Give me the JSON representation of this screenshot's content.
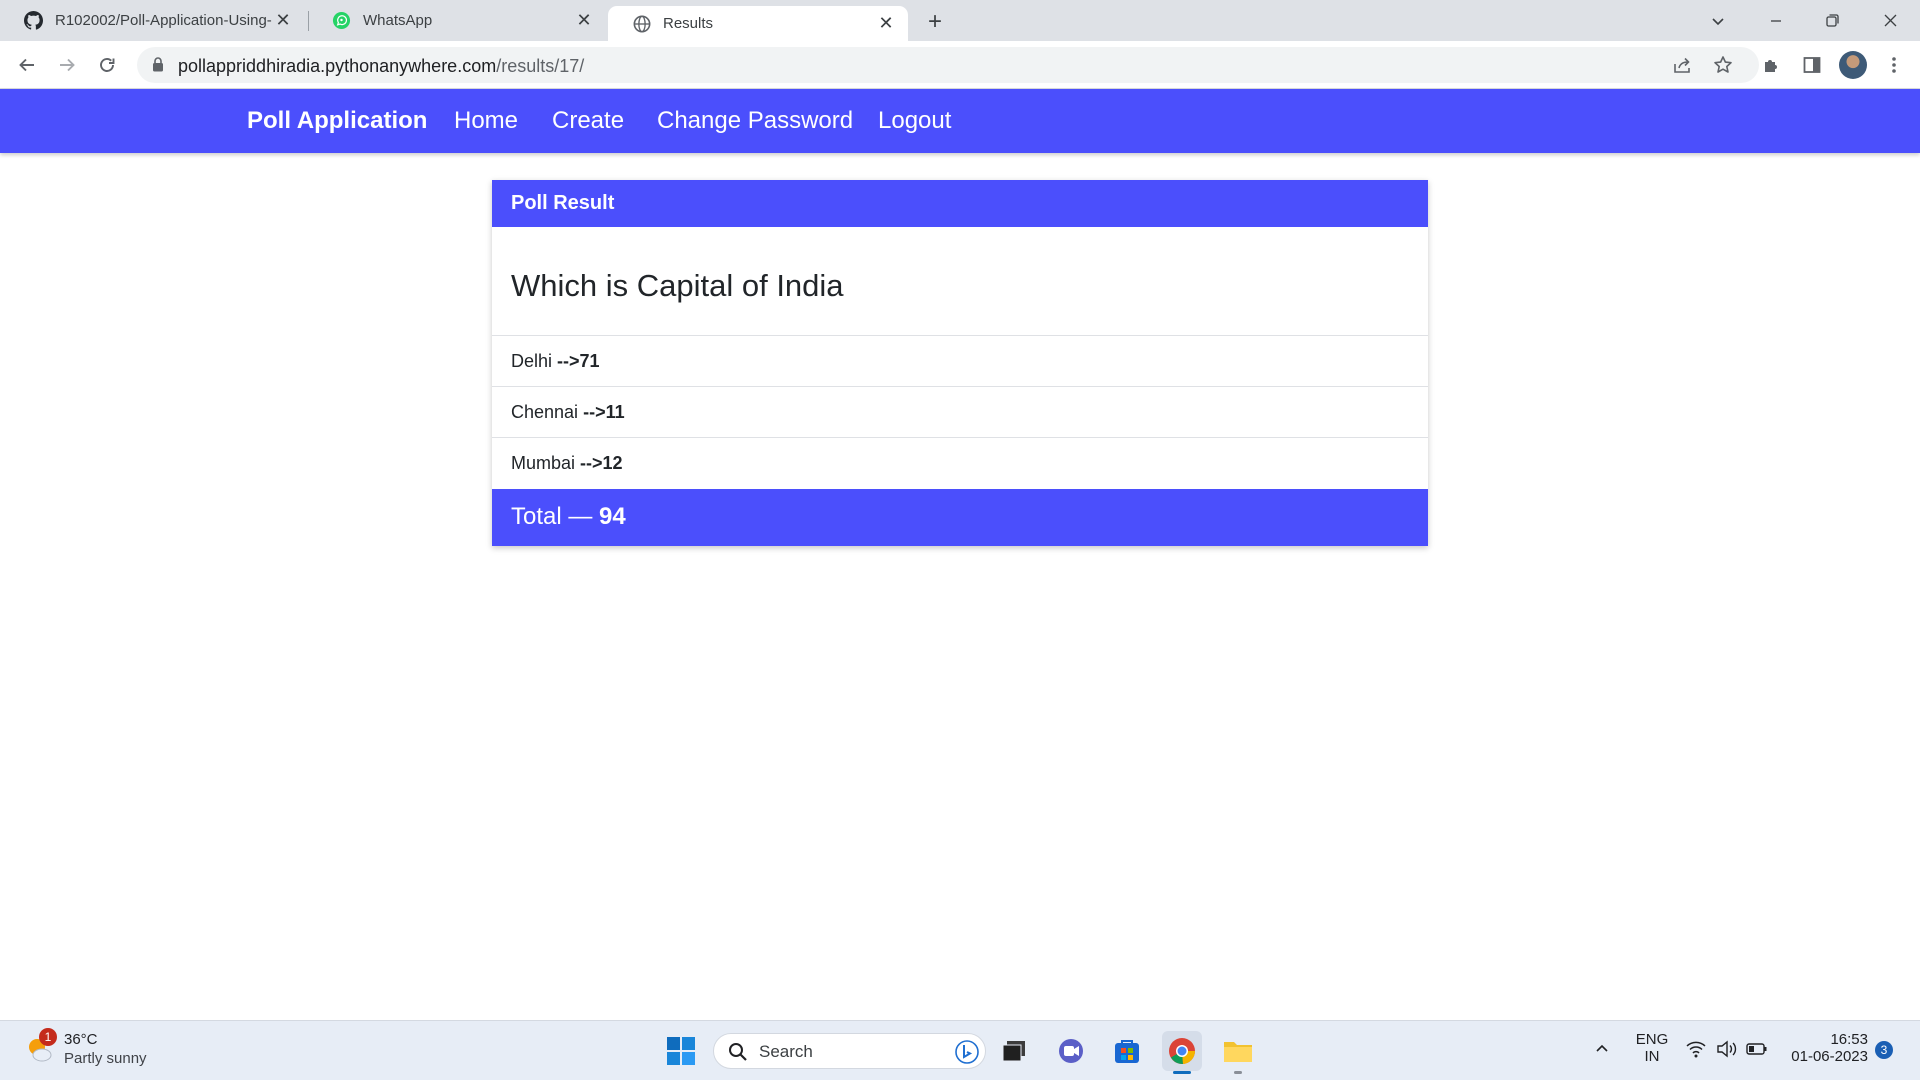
{
  "browser": {
    "tabs": [
      {
        "title": "R102002/Poll-Application-Using-",
        "icon": "github-icon"
      },
      {
        "title": "WhatsApp",
        "icon": "whatsapp-icon"
      },
      {
        "title": "Results",
        "icon": "globe-icon",
        "active": true
      }
    ],
    "url": {
      "host": "pollappriddhiradia.pythonanywhere.com",
      "path": "/results/17/"
    }
  },
  "navbar": {
    "brand": "Poll Application",
    "links": [
      "Home",
      "Create",
      "Change Password",
      "Logout"
    ],
    "color": "#4b4ffc"
  },
  "card": {
    "header": "Poll Result",
    "question": "Which is Capital of India",
    "choices": [
      {
        "label": "Delhi",
        "count": "-->71"
      },
      {
        "label": "Chennai",
        "count": "-->11"
      },
      {
        "label": "Mumbai",
        "count": "-->12"
      }
    ],
    "total_label": "Total —",
    "total_value": "94"
  },
  "taskbar": {
    "weather": {
      "temp": "36°C",
      "desc": "Partly sunny",
      "badge": "1"
    },
    "search_label": "Search",
    "lang": {
      "line1": "ENG",
      "line2": "IN"
    },
    "time": "16:53",
    "date": "01-06-2023",
    "notifications": "3"
  }
}
